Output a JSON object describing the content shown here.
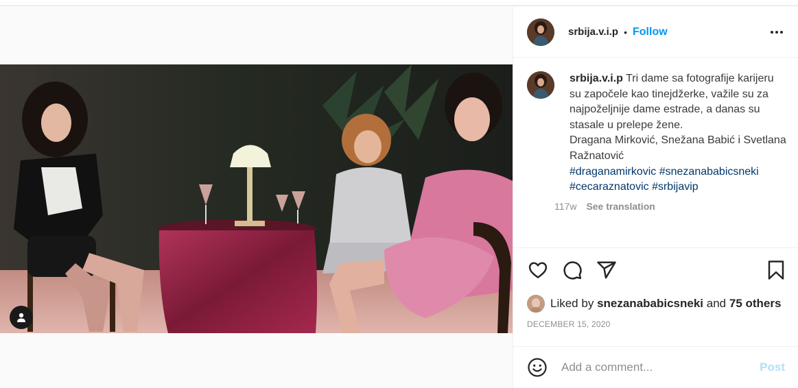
{
  "post": {
    "username": "srbija.v.i.p",
    "separator": "•",
    "follow_label": "Follow",
    "caption_text": "Tri dame sa fotografije karijeru su započele kao tinejdžerke, važile su za najpoželjnije dame estrade, a danas su stasale u prelepe žene.",
    "caption_names": "Dragana Mirković, Snežana Babić i Svetlana Ražnatović",
    "hashtags": [
      "#draganamirkovic",
      "#snezanababicsneki",
      "#cecaraznatovic",
      "#srbijavip"
    ],
    "age": "117w",
    "see_translation": "See translation",
    "liked_by_prefix": "Liked by",
    "liked_by_user": "snezanababicsneki",
    "liked_by_and": "and",
    "liked_by_others": "75 others",
    "date": "DECEMBER 15, 2020",
    "comment_placeholder": "Add a comment...",
    "post_label": "Post"
  },
  "icons": {
    "more": "more-options-icon",
    "like": "heart-icon",
    "comment": "comment-icon",
    "share": "share-icon",
    "save": "bookmark-icon",
    "tag": "user-tag-icon",
    "emoji": "emoji-icon"
  },
  "colors": {
    "follow": "#0095f6",
    "hashtag": "#00376b",
    "muted": "#8e8e8e",
    "post_disabled": "#b2dffc"
  }
}
